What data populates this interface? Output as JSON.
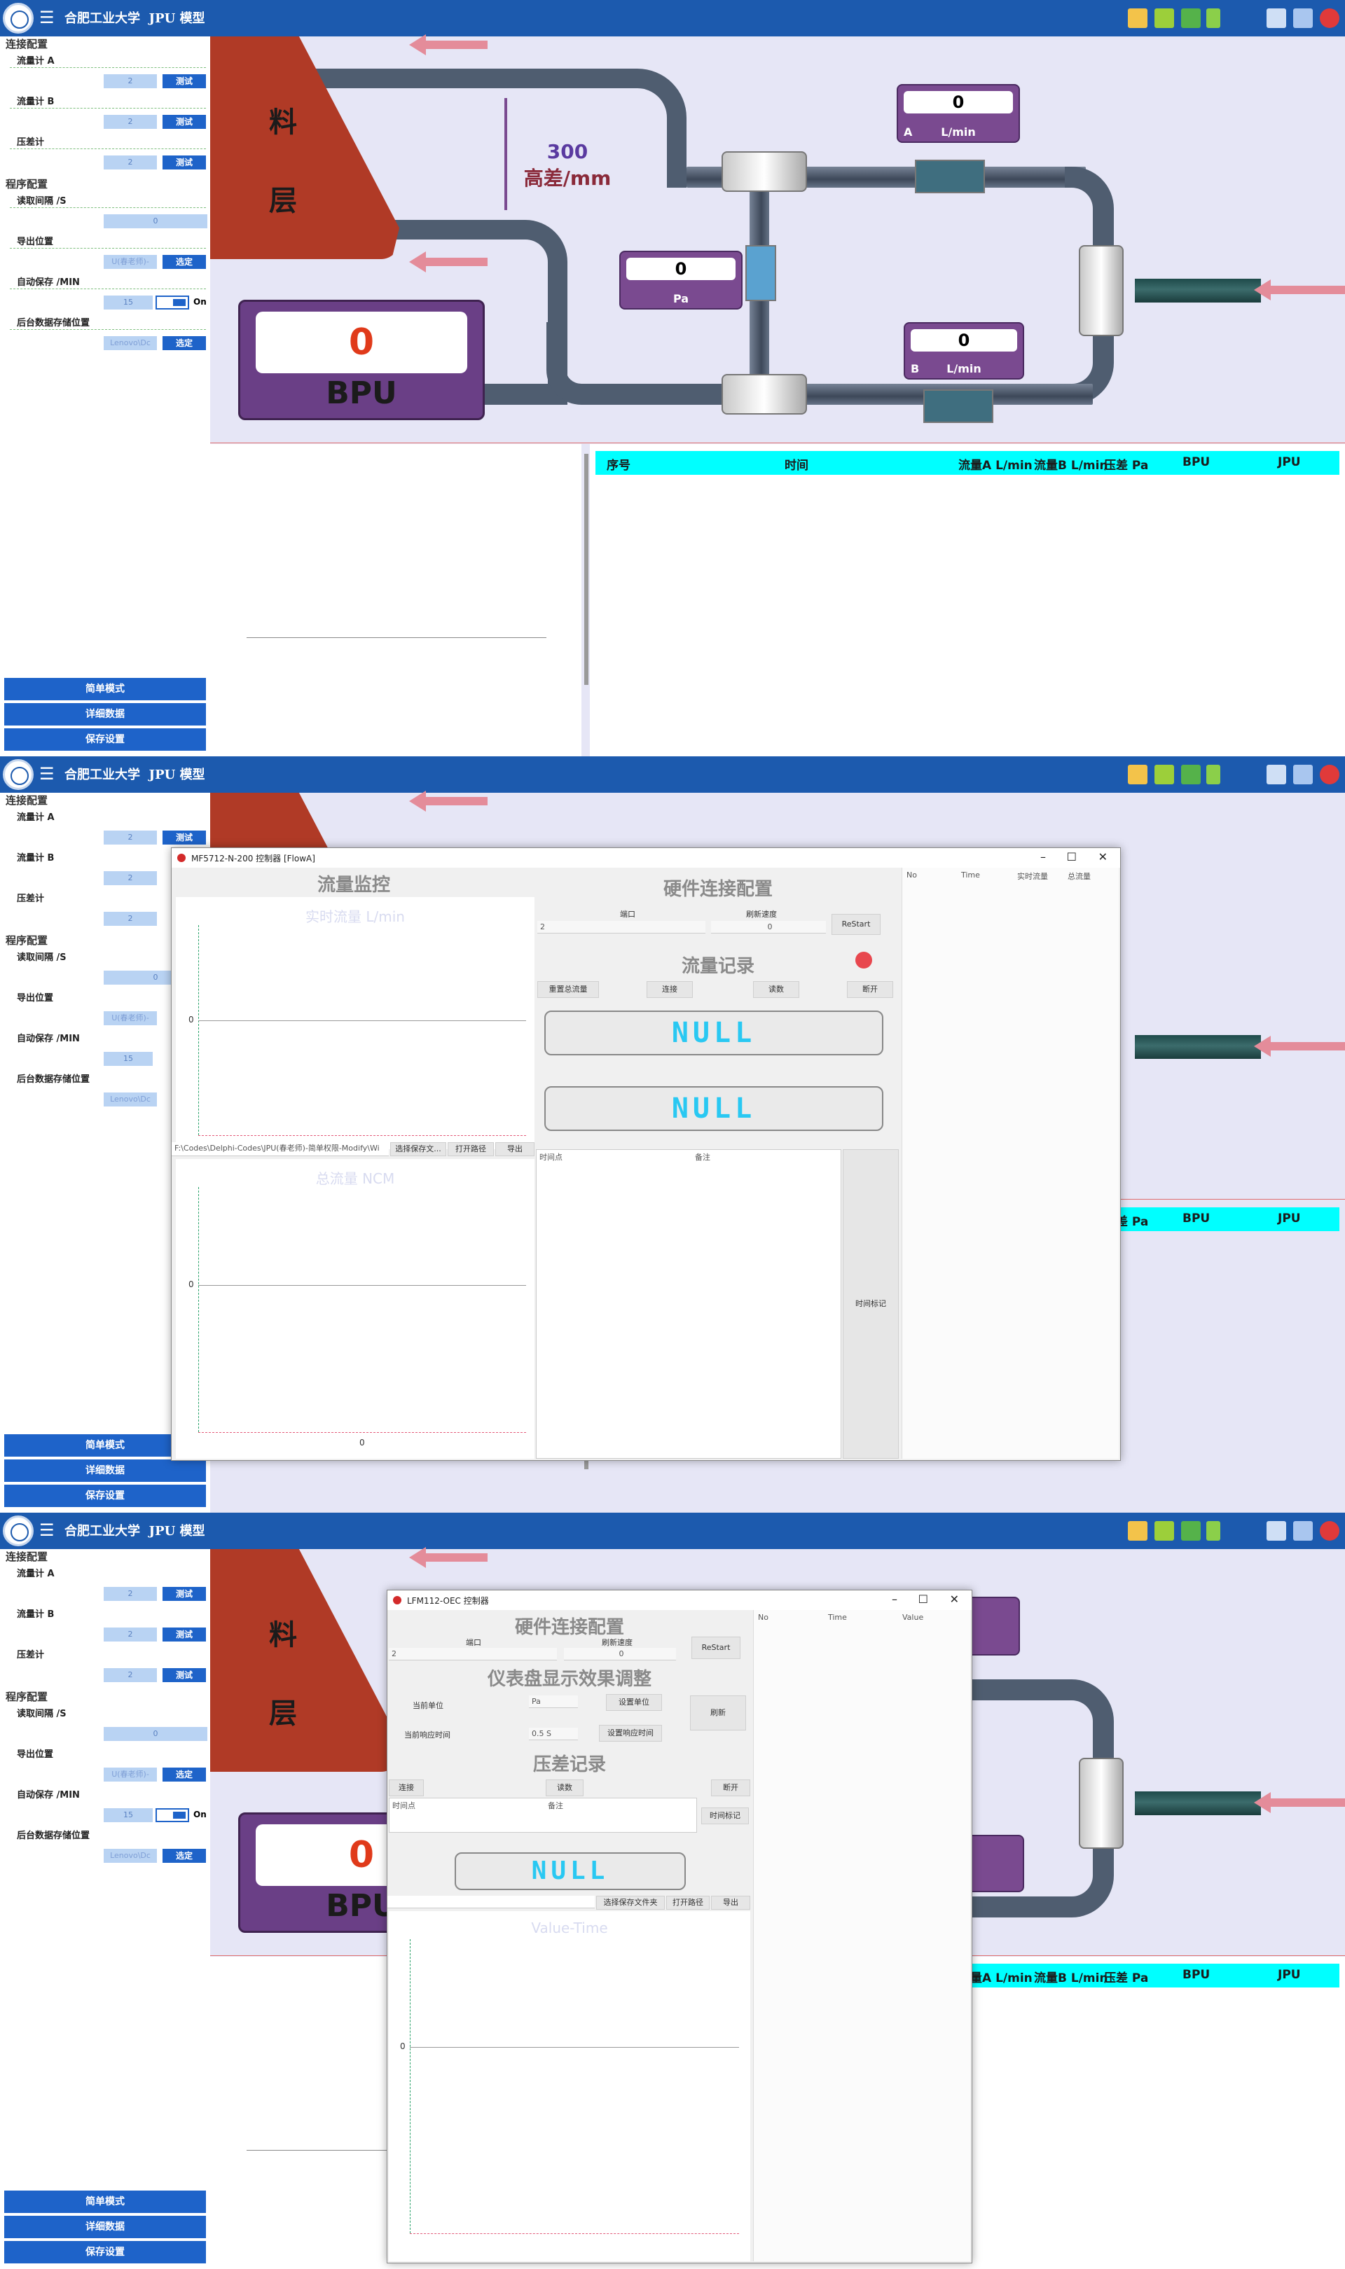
{
  "app": {
    "school": "合肥工业大学",
    "title": "JPU 模型"
  },
  "sidebar": {
    "connect_section": "连接配置",
    "flow_a": "流量计 A",
    "flow_b": "流量计 B",
    "diff": "压差计",
    "port_value": "2",
    "test_label": "测试",
    "program_section": "程序配置",
    "read_interval": "读取间隔 /S",
    "read_interval_value": "0",
    "export_location": "导出位置",
    "export_path": "U(春老师)-",
    "choose_label": "选定",
    "auto_save": "自动保存 /MIN",
    "auto_save_value": "15",
    "on_label": "On",
    "backend_location": "后台数据存储位置",
    "backend_path": "Lenovo\\Dc",
    "buttons": [
      "简单模式",
      "详细数据",
      "保存设置"
    ]
  },
  "diagram": {
    "hopper_chars": [
      "料",
      "层"
    ],
    "height_value": "300",
    "height_label": "高差/mm",
    "gauge_a": {
      "value": "0",
      "tag": "A",
      "unit": "L/min"
    },
    "gauge_pa": {
      "value": "0",
      "unit": "Pa"
    },
    "gauge_b": {
      "value": "0",
      "tag": "B",
      "unit": "L/min"
    },
    "bpu": {
      "value": "0",
      "label": "BPU"
    }
  },
  "table_header": [
    "序号",
    "时间",
    "流量A L/min",
    "流量B L/min",
    "压差 Pa",
    "BPU",
    "JPU"
  ],
  "flow_window": {
    "title": "MF5712-N-200 控制器  [FlowA]",
    "monitor_title": "流量监控",
    "hw_title": "硬件连接配置",
    "port_label": "端口",
    "port_value": "2",
    "rate_label": "刷新速度",
    "rate_value": "0",
    "restart": "ReStart",
    "record_title": "流量记录",
    "btn_reset": "重置总流量",
    "btn_connect": "连接",
    "btn_read": "读数",
    "btn_disconnect": "断开",
    "null1": "NULL",
    "null2": "NULL",
    "col_time": "时间点",
    "col_note": "备注",
    "time_mark": "时间标记",
    "realtime_title": "实时流量  L/min",
    "total_title": "总流量  NCM",
    "zero": "0",
    "path": "F:\\Codes\\Delphi-Codes\\JPU(春老师)-简单权限-Modify\\Wi",
    "btn_choose_folder": "选择保存文...",
    "btn_open": "打开路径",
    "btn_export": "导出",
    "list_cols": [
      "No",
      "Time",
      "实时流量",
      "总流量"
    ]
  },
  "diff_window": {
    "title": "LFM112-OEC 控制器",
    "hw_title": "硬件连接配置",
    "port_label": "端口",
    "port_value": "2",
    "rate_label": "刷新速度",
    "rate_value": "0",
    "restart": "ReStart",
    "display_title": "仪表盘显示效果调整",
    "unit_label": "当前单位",
    "unit_value": "Pa",
    "set_unit": "设置单位",
    "response_label": "当前响应时间",
    "response_value": "0.5 S",
    "set_response": "设置响应时间",
    "refresh": "刷新",
    "record_title": "压差记录",
    "btn_connect": "连接",
    "btn_read": "读数",
    "btn_disconnect": "断开",
    "col_time": "时间点",
    "col_note": "备注",
    "time_mark": "时间标记",
    "null": "NULL",
    "btn_choose_folder": "选择保存文件夹",
    "btn_open": "打开路径",
    "btn_export": "导出",
    "plot_title": "Value-Time",
    "zero": "0",
    "list_cols": [
      "No",
      "Time",
      "Value"
    ]
  },
  "colors": {
    "titlebar": "#1c5aae",
    "accent": "#1e63c9",
    "cyan": "#00ffff",
    "hopper": "#b03a26",
    "gauge": "#7a4a90"
  }
}
